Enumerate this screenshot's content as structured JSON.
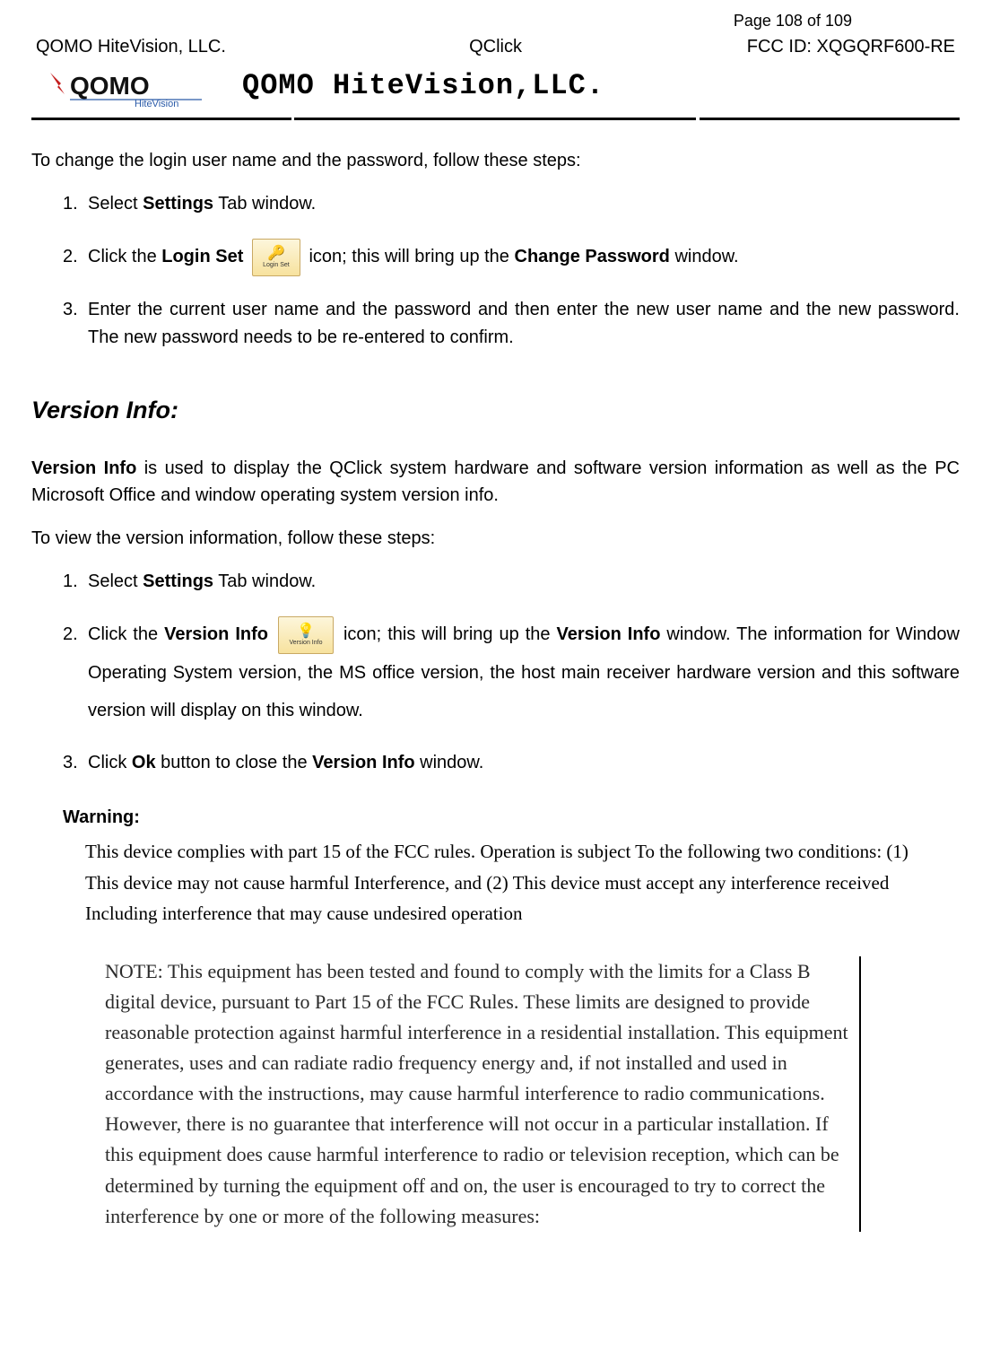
{
  "header": {
    "page_label": "Page ",
    "page_num": "108",
    "page_of": " of ",
    "page_total": "109",
    "company_left": "QOMO HiteVision, LLC.",
    "product_center": "QClick",
    "fcc_right": "FCC ID: XQGQRF600-RE",
    "company_title": "QOMO HiteVision,LLC.",
    "logo_main": "QOMO",
    "logo_sub": "HiteVision"
  },
  "login_section": {
    "intro": "To change the login user name and the password, follow these steps:",
    "step1_num": "1.",
    "step1_a": "Select ",
    "step1_b": "Settings",
    "step1_c": " Tab window.",
    "step2_num": "2.",
    "step2_a": "Click the ",
    "step2_b": "Login Set",
    "step2_icon_label": "Login Set",
    "step2_c": " icon; this will bring up the ",
    "step2_d": "Change Password",
    "step2_e": " window.",
    "step3_num": "3.",
    "step3": "Enter the current user name and the password and then enter the new user name and the new password. The new password needs to be re-entered to confirm."
  },
  "version_section": {
    "heading": "Version Info:",
    "intro_a": "Version Info",
    "intro_b": " is used to display the QClick system hardware and software version information as well as the PC Microsoft Office and window operating system version info.",
    "intro2": "To view the version information, follow these steps:",
    "step1_num": "1.",
    "step1_a": "Select ",
    "step1_b": "Settings",
    "step1_c": " Tab window.",
    "step2_num": "2.",
    "step2_a": "Click  the  ",
    "step2_b": "Version  Info",
    "step2_icon_label": "Version Info",
    "step2_c": "  icon;  this  will  bring  up  the  ",
    "step2_d": "Version  Info",
    "step2_e": "  window.  The information  for  Window  Operating  System  version,  the  MS  office  version,  the  host  main receiver hardware version and this software version will display on this window.",
    "step3_num": "3.",
    "step3_a": "Click ",
    "step3_b": "Ok",
    "step3_c": " button to close the ",
    "step3_d": "Version Info",
    "step3_e": " window."
  },
  "warning": {
    "heading": "Warning:",
    "body": "This device complies with part 15 of the FCC rules. Operation is subject To the following two conditions: (1) This device may not cause harmful Interference, and (2) This device must accept any interference received Including interference that may cause undesired operation"
  },
  "note": {
    "body": "NOTE:  This equipment has been tested and found to comply with the limits for a Class B digital device, pursuant to Part 15 of the FCC Rules.  These limits are designed to provide reasonable protection against harmful interference in a residential installation.  This equipment generates, uses and can radiate radio frequency energy and, if not installed and used in accordance with the instructions, may cause harmful interference to radio communications.  However, there is no guarantee that interference will not occur in a particular installation.  If this equipment does cause harmful interference to radio or television reception, which can be determined by turning the equipment off and on, the user is encouraged to try to correct the interference by one or more of the following measures:"
  }
}
